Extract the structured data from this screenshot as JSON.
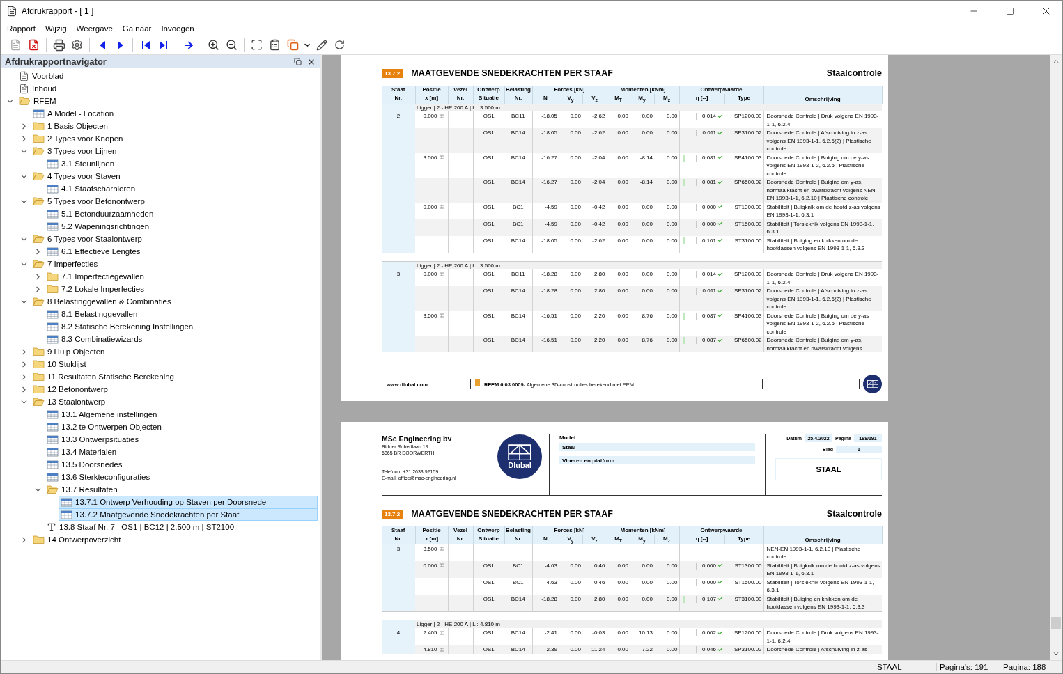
{
  "window": {
    "title": "Afdrukrapport - [ 1 ]"
  },
  "menu": [
    "Rapport",
    "Wijzig",
    "Weergave",
    "Ga naar",
    "Invoegen"
  ],
  "navigator": {
    "title": "Afdrukrapportnavigator",
    "items": [
      {
        "label": "Voorblad",
        "kind": "page",
        "selected": false
      },
      {
        "label": "Inhoud",
        "kind": "page",
        "selected": false
      },
      {
        "label": "RFEM",
        "kind": "folder",
        "expanded": true,
        "selected": false,
        "children": [
          {
            "label": "A Model - Location",
            "kind": "table",
            "selected": false
          },
          {
            "label": "1 Basis Objecten",
            "kind": "folder",
            "expanded": false,
            "selected": false
          },
          {
            "label": "2 Types voor Knopen",
            "kind": "folder",
            "expanded": false,
            "selected": false
          },
          {
            "label": "3 Types voor Lijnen",
            "kind": "folder",
            "expanded": true,
            "selected": false,
            "children": [
              {
                "label": "3.1 Steunlijnen",
                "kind": "table",
                "selected": false
              }
            ]
          },
          {
            "label": "4 Types voor Staven",
            "kind": "folder",
            "expanded": true,
            "selected": false,
            "children": [
              {
                "label": "4.1 Staafscharnieren",
                "kind": "table",
                "selected": false
              }
            ]
          },
          {
            "label": "5 Types voor Betonontwerp",
            "kind": "folder",
            "expanded": true,
            "selected": false,
            "children": [
              {
                "label": "5.1 Betonduurzaamheden",
                "kind": "table",
                "selected": false
              },
              {
                "label": "5.2 Wapeningsrichtingen",
                "kind": "table",
                "selected": false
              }
            ]
          },
          {
            "label": "6 Types voor Staalontwerp",
            "kind": "folder",
            "expanded": true,
            "selected": false,
            "children": [
              {
                "label": "6.1 Effectieve Lengtes",
                "kind": "table",
                "expanded": false,
                "selected": false
              }
            ]
          },
          {
            "label": "7 Imperfecties",
            "kind": "folder",
            "expanded": true,
            "selected": false,
            "children": [
              {
                "label": "7.1 Imperfectiegevallen",
                "kind": "folder",
                "expanded": false,
                "selected": false
              },
              {
                "label": "7.2 Lokale Imperfecties",
                "kind": "folder",
                "expanded": false,
                "selected": false
              }
            ]
          },
          {
            "label": "8 Belastinggevallen & Combinaties",
            "kind": "folder",
            "expanded": true,
            "selected": false,
            "children": [
              {
                "label": "8.1 Belastinggevallen",
                "kind": "table",
                "selected": false
              },
              {
                "label": "8.2 Statische Berekening Instellingen",
                "kind": "table",
                "selected": false
              },
              {
                "label": "8.3 Combinatiewizards",
                "kind": "table",
                "selected": false
              }
            ]
          },
          {
            "label": "9 Hulp Objecten",
            "kind": "folder",
            "expanded": false,
            "selected": false
          },
          {
            "label": "10 Stuklijst",
            "kind": "folder",
            "expanded": false,
            "selected": false
          },
          {
            "label": "11 Resultaten Statische Berekening",
            "kind": "folder",
            "expanded": false,
            "selected": false
          },
          {
            "label": "12 Betonontwerp",
            "kind": "folder",
            "expanded": false,
            "selected": false
          },
          {
            "label": "13 Staalontwerp",
            "kind": "folder",
            "expanded": true,
            "selected": false,
            "children": [
              {
                "label": "13.1 Algemene instellingen",
                "kind": "table",
                "selected": false
              },
              {
                "label": "13.2 te Ontwerpen Objecten",
                "kind": "table",
                "selected": false
              },
              {
                "label": "13.3 Ontwerpsituaties",
                "kind": "table",
                "selected": false
              },
              {
                "label": "13.4 Materialen",
                "kind": "table",
                "selected": false
              },
              {
                "label": "13.5 Doorsnedes",
                "kind": "table",
                "selected": false
              },
              {
                "label": "13.6 Sterkteconfiguraties",
                "kind": "table",
                "selected": false
              },
              {
                "label": "13.7 Resultaten",
                "kind": "folder",
                "expanded": true,
                "selected": false,
                "children": [
                  {
                    "label": "13.7.1 Ontwerp Verhouding op Staven per Doorsnede",
                    "kind": "table",
                    "selected": true
                  },
                  {
                    "label": "13.7.2 Maatgevende Snedekrachten per Staaf",
                    "kind": "table",
                    "selected": true
                  }
                ]
              },
              {
                "label": "13.8 Staaf Nr. 7 | OS1 | BC12 | 2.500 m | ST2100",
                "kind": "text",
                "selected": false
              }
            ]
          },
          {
            "label": "14 Ontwerpoverzicht",
            "kind": "folder",
            "expanded": false,
            "selected": false
          }
        ]
      }
    ]
  },
  "pages": [
    {
      "section": {
        "number": "13.7.2",
        "title": "MAATGEVENDE SNEDEKRACHTEN PER STAAF",
        "category": "Staalcontrole"
      },
      "table": {
        "columns": [
          {
            "top": "Staaf",
            "bottom": "Nr."
          },
          {
            "top": "Positie",
            "bottom": "x [m]"
          },
          {
            "top": "Vezel",
            "bottom": "Nr."
          },
          {
            "top": "Ontwerp",
            "bottom": "Situatie"
          },
          {
            "top": "Belasting",
            "bottom": "Nr."
          }
        ],
        "column_groups": [
          {
            "label": "Forces [kN]",
            "subs": [
              "N",
              "V$_{y}$",
              "V$_{z}$"
            ]
          },
          {
            "label": "Momenten [kNm]",
            "subs": [
              "M$_{T}$",
              "M$_{y}$",
              "M$_{z}$"
            ]
          },
          {
            "label": "Ontwerpwaarde",
            "subs": [
              "η [--]",
              "Type"
            ]
          }
        ],
        "last_column": "Omschrijving",
        "groups": [
          {
            "member": "Ligger | 2 - HE 200 A | L : 3.500 m",
            "rows": [
              {
                "staaf": "2",
                "positie": "0.000",
                "situatie": "OS1",
                "belasting": "BC11",
                "values": [
                  "-18.05",
                  "0.00",
                  "-2.62",
                  "0.00",
                  "0.00",
                  "0.00"
                ],
                "level": 0.014,
                "eta": "0.014",
                "type": "SP1200.00",
                "desc": "Doorsnede Controle | Druk volgens EN 1993-1-1, 6.2.4"
              },
              {
                "situatie": "OS1",
                "belasting": "BC14",
                "values": [
                  "-18.05",
                  "0.00",
                  "-2.62",
                  "0.00",
                  "0.00",
                  "0.00"
                ],
                "level": 0.011,
                "eta": "0.011",
                "type": "SP3100.02",
                "desc": "Doorsnede Controle | Afschuiving in z-as volgens EN 1993-1-1, 6.2.6(2) | Plastische controle"
              },
              {
                "positie": "3.500",
                "situatie": "OS1",
                "belasting": "BC14",
                "values": [
                  "-16.27",
                  "0.00",
                  "-2.04",
                  "0.00",
                  "-8.14",
                  "0.00"
                ],
                "level": 0.081,
                "eta": "0.081",
                "type": "SP4100.03",
                "desc": "Doorsnede Controle | Buiging om de y-as volgens EN 1993-1-2, 6.2.5 | Plastische controle"
              },
              {
                "situatie": "OS1",
                "belasting": "BC14",
                "values": [
                  "-16.27",
                  "0.00",
                  "-2.04",
                  "0.00",
                  "-8.14",
                  "0.00"
                ],
                "level": 0.081,
                "eta": "0.081",
                "type": "SP6500.02",
                "desc": "Doorsnede Controle | Buiging om y-as, normaalkracht en dwarskracht volgens NEN-EN 1993-1-1, 6.2.10 | Plastische controle"
              },
              {
                "positie": "0.000",
                "situatie": "OS1",
                "belasting": "BC1",
                "values": [
                  "-4.59",
                  "0.00",
                  "-0.42",
                  "0.00",
                  "0.00",
                  "0.00"
                ],
                "level": 0.0,
                "eta": "0.000",
                "type": "ST1300.00",
                "desc": "Stabiliteit | Buigknik om de hoofd z-as volgens EN 1993-1-1, 6.3.1"
              },
              {
                "situatie": "OS1",
                "belasting": "BC1",
                "values": [
                  "-4.59",
                  "0.00",
                  "-0.42",
                  "0.00",
                  "0.00",
                  "0.00"
                ],
                "level": 0.0,
                "eta": "0.000",
                "type": "ST1500.00",
                "desc": "Stabiliteit | Torsieknik volgens EN 1993-1-1, 6.3.1"
              },
              {
                "situatie": "OS1",
                "belasting": "BC14",
                "values": [
                  "-18.05",
                  "0.00",
                  "-2.62",
                  "0.00",
                  "0.00",
                  "0.00"
                ],
                "level": 0.101,
                "eta": "0.101",
                "type": "ST3100.00",
                "desc": "Stabiliteit | Buiging en knikken om de hoofdassen volgens EN 1993-1-1, 6.3.3"
              }
            ]
          },
          {
            "member": "Ligger | 2 - HE 200 A | L : 3.500 m",
            "rows": [
              {
                "staaf": "3",
                "positie": "0.000",
                "situatie": "OS1",
                "belasting": "BC11",
                "values": [
                  "-18.28",
                  "0.00",
                  "2.80",
                  "0.00",
                  "0.00",
                  "0.00"
                ],
                "level": 0.014,
                "eta": "0.014",
                "type": "SP1200.00",
                "desc": "Doorsnede Controle | Druk volgens EN 1993-1-1, 6.2.4"
              },
              {
                "situatie": "OS1",
                "belasting": "BC14",
                "values": [
                  "-18.28",
                  "0.00",
                  "2.80",
                  "0.00",
                  "0.00",
                  "0.00"
                ],
                "level": 0.011,
                "eta": "0.011",
                "type": "SP3100.02",
                "desc": "Doorsnede Controle | Afschuiving in z-as volgens EN 1993-1-1, 6.2.6(2) | Plastische controle"
              },
              {
                "positie": "3.500",
                "situatie": "OS1",
                "belasting": "BC14",
                "values": [
                  "-16.51",
                  "0.00",
                  "2.20",
                  "0.00",
                  "8.76",
                  "0.00"
                ],
                "level": 0.087,
                "eta": "0.087",
                "type": "SP4100.03",
                "desc": "Doorsnede Controle | Buiging om de y-as volgens EN 1993-1-2, 6.2.5 | Plastische controle"
              },
              {
                "situatie": "OS1",
                "belasting": "BC14",
                "values": [
                  "-16.51",
                  "0.00",
                  "2.20",
                  "0.00",
                  "8.76",
                  "0.00"
                ],
                "level": 0.087,
                "eta": "0.087",
                "type": "SP6500.02",
                "desc": "Doorsnede Controle | Buiging om y-as, normaalkracht en dwarskracht volgens"
              }
            ]
          }
        ]
      },
      "footer": {
        "site": "www.dlubal.com",
        "product": "RFEM 6.03.0009",
        "tagline": "- Algemene 3D-constructies berekend met EEM"
      }
    },
    {
      "header": {
        "company": "MSc Engineering bv",
        "address": [
          "Ridder Robertlaan 19",
          "6865 BR DOORWERTH"
        ],
        "contact": [
          "Telefoon: +31 2633 92159",
          "E-mail: office@msc-engineering.nl"
        ],
        "logo_text": "Dlubal",
        "model_label": "Model:",
        "model_values": [
          "Staal",
          "Vloeren en platform"
        ],
        "datum_label": "Datum",
        "datum": "25.4.2022",
        "pagina_label": "Pagina",
        "pagina": "188/191",
        "blad_label": "Blad",
        "blad": "1",
        "title": "STAAL"
      },
      "section": {
        "number": "13.7.2",
        "title": "MAATGEVENDE SNEDEKRACHTEN PER STAAF",
        "category": "Staalcontrole"
      },
      "table": {
        "columns": [
          {
            "top": "Staaf",
            "bottom": "Nr."
          },
          {
            "top": "Positie",
            "bottom": "x [m]"
          },
          {
            "top": "Vezel",
            "bottom": "Nr."
          },
          {
            "top": "Ontwerp",
            "bottom": "Situatie"
          },
          {
            "top": "Belasting",
            "bottom": "Nr."
          }
        ],
        "column_groups": [
          {
            "label": "Forces [kN]",
            "subs": [
              "N",
              "V$_{y}$",
              "V$_{z}$"
            ]
          },
          {
            "label": "Momenten [kNm]",
            "subs": [
              "M$_{T}$",
              "M$_{y}$",
              "M$_{z}$"
            ]
          },
          {
            "label": "Ontwerpwaarde",
            "subs": [
              "η [--]",
              "Type"
            ]
          }
        ],
        "last_column": "Omschrijving",
        "groups": [
          {
            "rows": [
              {
                "staaf": "3",
                "positie": "3.500",
                "desc": "NEN-EN 1993-1-1, 6.2.10 | Plastische controle"
              },
              {
                "positie": "0.000",
                "situatie": "OS1",
                "belasting": "BC1",
                "values": [
                  "-4.63",
                  "0.00",
                  "0.46",
                  "0.00",
                  "0.00",
                  "0.00"
                ],
                "level": 0.0,
                "eta": "0.000",
                "type": "ST1300.00",
                "desc": "Stabiliteit | Buigknik om de hoofd z-as volgens EN 1993-1-1, 6.3.1"
              },
              {
                "situatie": "OS1",
                "belasting": "BC1",
                "values": [
                  "-4.63",
                  "0.00",
                  "0.46",
                  "0.00",
                  "0.00",
                  "0.00"
                ],
                "level": 0.0,
                "eta": "0.000",
                "type": "ST1500.00",
                "desc": "Stabiliteit | Torsieknik volgens EN 1993-1-1, 6.3.1"
              },
              {
                "situatie": "OS1",
                "belasting": "BC14",
                "values": [
                  "-18.28",
                  "0.00",
                  "2.80",
                  "0.00",
                  "0.00",
                  "0.00"
                ],
                "level": 0.107,
                "eta": "0.107",
                "type": "ST3100.00",
                "desc": "Stabiliteit | Buiging en knikken om de hoofdassen volgens EN 1993-1-1, 6.3.3"
              }
            ]
          },
          {
            "member": "Ligger | 2 - HE 200 A | L : 4.810 m",
            "rows": [
              {
                "staaf": "4",
                "positie": "2.405",
                "situatie": "OS1",
                "belasting": "BC14",
                "values": [
                  "-2.41",
                  "0.00",
                  "-0.03",
                  "0.00",
                  "10.13",
                  "0.00"
                ],
                "level": 0.002,
                "eta": "0.002",
                "type": "SP1200.00",
                "desc": "Doorsnede Controle | Druk volgens EN 1993-1-1, 6.2.4"
              },
              {
                "positie": "4.810",
                "situatie": "OS1",
                "belasting": "BC14",
                "values": [
                  "-2.39",
                  "0.00",
                  "-11.24",
                  "0.00",
                  "-7.22",
                  "0.00"
                ],
                "level": 0.046,
                "eta": "0.046",
                "type": "SP3100.02",
                "desc": "Doorsnede Controle | Afschuiving in z-as"
              }
            ]
          }
        ]
      }
    }
  ],
  "status_bar": {
    "document": "STAAL",
    "pages": "Pagina's: 191",
    "page": "Pagina: 188"
  }
}
